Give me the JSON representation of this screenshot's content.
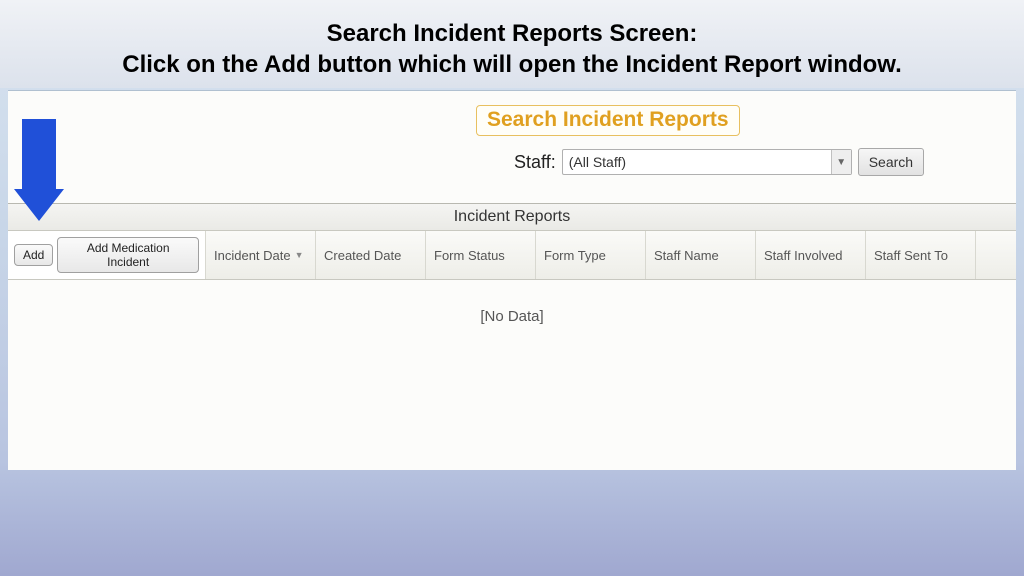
{
  "slide": {
    "title_line1": "Search Incident Reports Screen:",
    "title_line2": "Click on the Add button which will open the Incident Report window."
  },
  "search_panel": {
    "heading": "Search Incident Reports",
    "staff_label": "Staff:",
    "staff_value": "(All Staff)",
    "search_button": "Search"
  },
  "grid": {
    "title": "Incident Reports",
    "add_button": "Add",
    "add_med_button": "Add Medication Incident",
    "columns": {
      "incident_date": "Incident Date",
      "created_date": "Created Date",
      "form_status": "Form Status",
      "form_type": "Form Type",
      "staff_name": "Staff Name",
      "staff_involved": "Staff Involved",
      "staff_sent_to": "Staff Sent To"
    },
    "no_data": "[No Data]"
  }
}
